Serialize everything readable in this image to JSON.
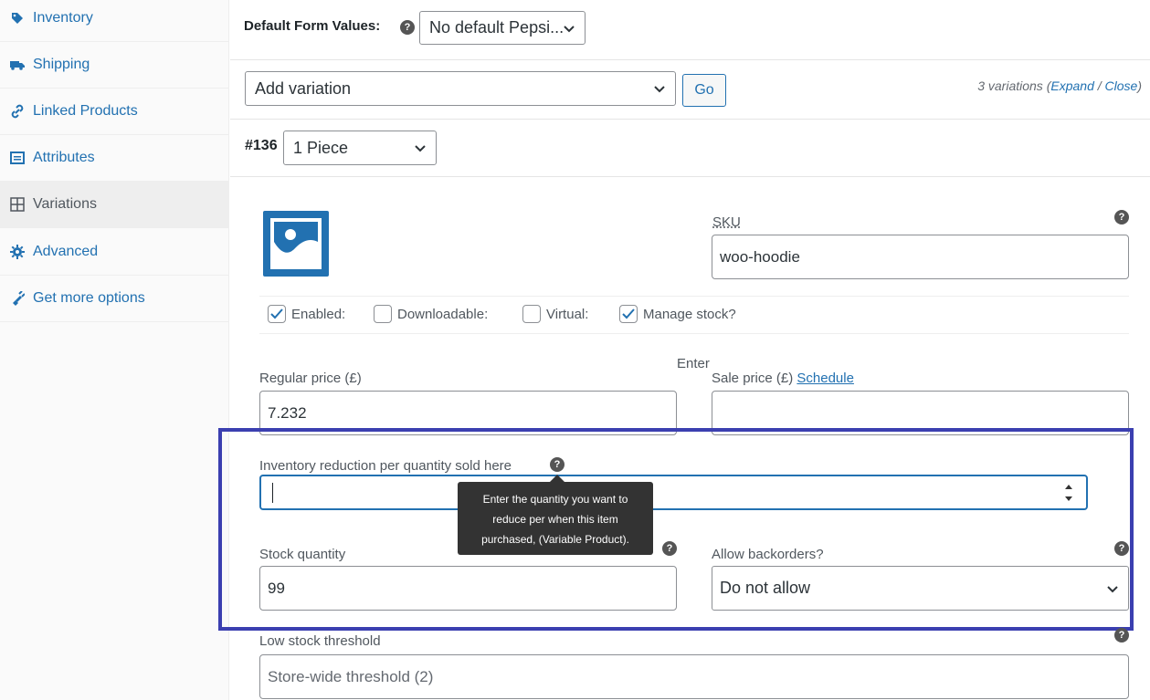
{
  "sidebar": {
    "items": [
      {
        "label": "Inventory",
        "icon": "tag-icon"
      },
      {
        "label": "Shipping",
        "icon": "truck-icon"
      },
      {
        "label": "Linked Products",
        "icon": "link-icon"
      },
      {
        "label": "Attributes",
        "icon": "list-icon"
      },
      {
        "label": "Variations",
        "icon": "grid-icon",
        "active": true
      },
      {
        "label": "Advanced",
        "icon": "gear-icon"
      },
      {
        "label": "Get more options",
        "icon": "plugin-icon"
      }
    ]
  },
  "defaults": {
    "label": "Default Form Values:",
    "help": "?",
    "value": "No default Pepsi..."
  },
  "toolbar": {
    "add_variation": "Add variation",
    "go": "Go",
    "count_text": "3 variations (",
    "expand": "Expand",
    "sep": " / ",
    "close": "Close",
    "close_paren": ")"
  },
  "variation": {
    "id": "#136",
    "attribute": "1 Piece",
    "sku_label": "SKU",
    "sku_value": "woo-hoodie",
    "checkboxes": {
      "enabled": {
        "label": "Enabled:",
        "checked": true
      },
      "downloadable": {
        "label": "Downloadable:",
        "checked": false
      },
      "virtual": {
        "label": "Virtual:",
        "checked": false
      },
      "manage_stock": {
        "label": "Manage stock?",
        "checked": true
      }
    },
    "enter_text": "Enter",
    "regular_price_label": "Regular price (£)",
    "regular_price": "7.232",
    "sale_price_label": "Sale price (£)",
    "schedule": "Schedule",
    "sale_price": "",
    "reduction_label": "Inventory reduction per quantity sold here",
    "reduction_value": "",
    "tooltip": {
      "line1": "Enter the quantity you want to",
      "line2": "reduce per when this item",
      "line3": "purchased, (Variable Product)."
    },
    "stock_label": "Stock quantity",
    "stock_value": "99",
    "backorders_label": "Allow backorders?",
    "backorders_value": "Do not allow",
    "low_stock_label": "Low stock threshold",
    "low_stock_placeholder": "Store-wide threshold (2)"
  },
  "colors": {
    "link": "#2271b1",
    "highlight": "#3b3fb0",
    "tooltip_bg": "#333333",
    "image_blue": "#2271b1"
  }
}
